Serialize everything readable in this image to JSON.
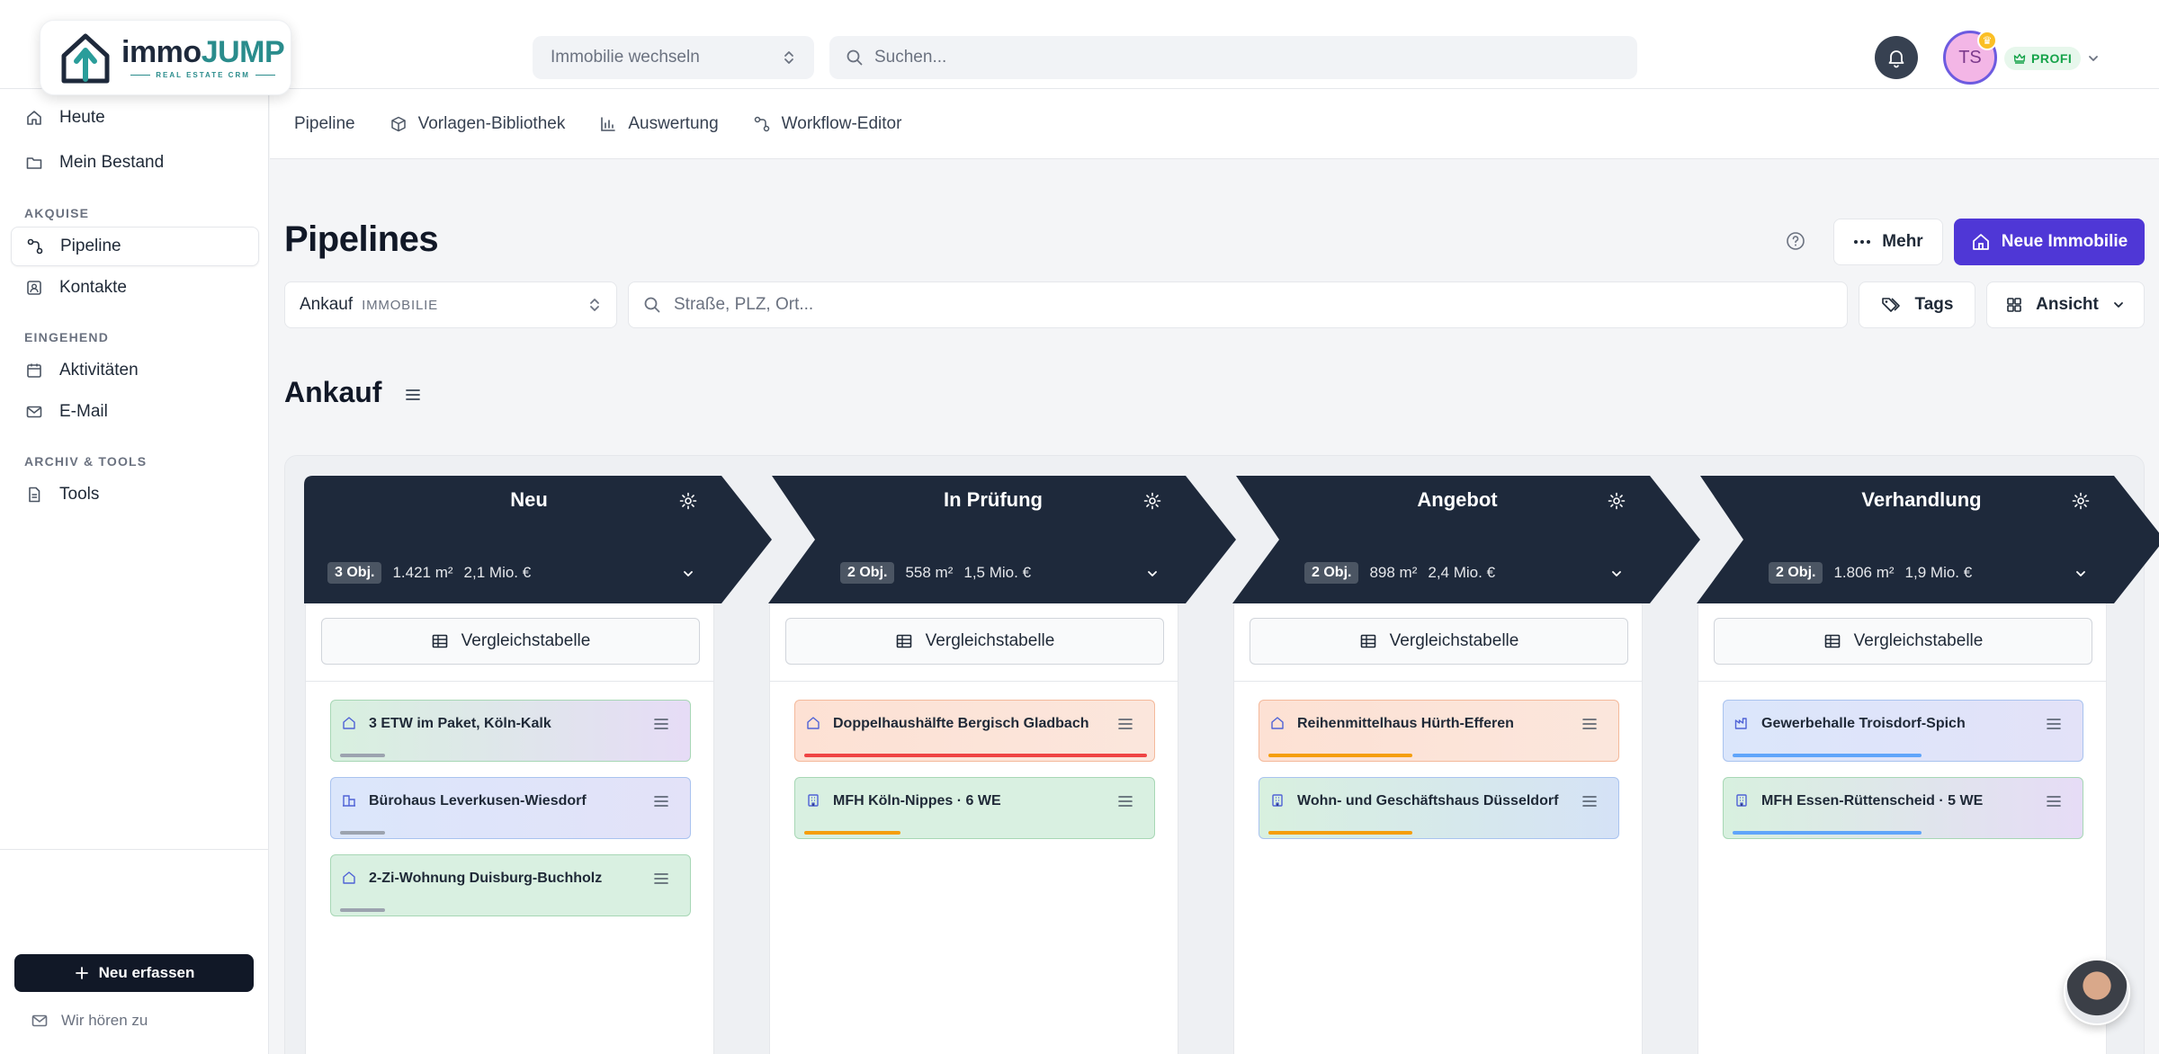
{
  "logo": {
    "word_1": "immo",
    "word_2": "JUMP",
    "tagline": "REAL ESTATE CRM"
  },
  "topbar": {
    "property_switch_label": "Immobilie wechseln",
    "search_placeholder": "Suchen...",
    "avatar_initials": "TS",
    "plan_badge": "PROFI"
  },
  "sidebar": {
    "items_top": [
      {
        "label": "Heute",
        "icon": "home-icon"
      },
      {
        "label": "Mein Bestand",
        "icon": "folder-icon"
      }
    ],
    "section_akquise": "AKQUISE",
    "items_akquise": [
      {
        "label": "Pipeline",
        "icon": "pipeline-icon",
        "active": true
      },
      {
        "label": "Kontakte",
        "icon": "contacts-icon"
      }
    ],
    "section_eingehend": "EINGEHEND",
    "items_eingehend": [
      {
        "label": "Aktivitäten",
        "icon": "calendar-icon"
      },
      {
        "label": "E-Mail",
        "icon": "mail-icon"
      }
    ],
    "section_archiv": "ARCHIV & TOOLS",
    "items_archiv": [
      {
        "label": "Tools",
        "icon": "document-icon"
      }
    ],
    "new_button": "Neu erfassen",
    "feedback": "Wir hören zu"
  },
  "subnav": [
    {
      "label": "Pipeline"
    },
    {
      "label": "Vorlagen-Bibliothek",
      "icon": "cube-icon"
    },
    {
      "label": "Auswertung",
      "icon": "chart-icon"
    },
    {
      "label": "Workflow-Editor",
      "icon": "workflow-icon"
    }
  ],
  "main": {
    "title": "Pipelines",
    "more_button": "Mehr",
    "primary_button": "Neue Immobilie",
    "pipeline_select": "Ankauf",
    "pipeline_select_sub": "IMMOBILIE",
    "address_search_placeholder": "Straße, PLZ, Ort...",
    "tags_button": "Tags",
    "view_button": "Ansicht",
    "section_title": "Ankauf"
  },
  "columns": [
    {
      "title": "Neu",
      "count": "3 Obj.",
      "area": "1.421 m²",
      "value": "2,1 Mio. €",
      "compare_label": "Vergleichstabelle",
      "cards": [
        {
          "title": "3 ETW im Paket, Köln-Kalk",
          "icon": "home-icon",
          "theme": "green-purple",
          "progress": 0.13,
          "bar_color": "#9ca3af"
        },
        {
          "title": "Bürohaus Leverkusen-Wiesdorf",
          "icon": "office-icon",
          "theme": "blue",
          "progress": 0.13,
          "bar_color": "#9ca3af"
        },
        {
          "title": "2-Zi-Wohnung Duisburg-Buchholz",
          "icon": "home-icon",
          "theme": "green",
          "progress": 0.13,
          "bar_color": "#9ca3af"
        }
      ]
    },
    {
      "title": "In Prüfung",
      "count": "2 Obj.",
      "area": "558 m²",
      "value": "1,5 Mio. €",
      "compare_label": "Vergleichstabelle",
      "cards": [
        {
          "title": "Doppelhaushälfte Bergisch Gladbach",
          "icon": "home-icon",
          "theme": "orange",
          "progress": 1.0,
          "bar_color": "#ef4444"
        },
        {
          "title": "MFH Köln-Nippes · 6 WE",
          "icon": "building-icon",
          "theme": "green",
          "progress": 0.28,
          "bar_color": "#f59e0b"
        }
      ]
    },
    {
      "title": "Angebot",
      "count": "2 Obj.",
      "area": "898 m²",
      "value": "2,4 Mio. €",
      "compare_label": "Vergleichstabelle",
      "cards": [
        {
          "title": "Reihenmittelhaus Hürth-Efferen",
          "icon": "home-icon",
          "theme": "orange",
          "progress": 0.42,
          "bar_color": "#f59e0b"
        },
        {
          "title": "Wohn- und Geschäftshaus Düsseldorf",
          "icon": "building-icon",
          "theme": "green-blue",
          "progress": 0.42,
          "bar_color": "#f59e0b"
        }
      ]
    },
    {
      "title": "Verhandlung",
      "count": "2 Obj.",
      "area": "1.806 m²",
      "value": "1,9 Mio. €",
      "compare_label": "Vergleichstabelle",
      "cards": [
        {
          "title": "Gewerbehalle Troisdorf-Spich",
          "icon": "factory-icon",
          "theme": "blue",
          "progress": 0.55,
          "bar_color": "#60a5fa"
        },
        {
          "title": "MFH Essen-Rüttenscheid · 5 WE",
          "icon": "building-icon",
          "theme": "green-purple",
          "progress": 0.55,
          "bar_color": "#60a5fa"
        }
      ]
    }
  ],
  "colors": {
    "primary": "#4f37d6",
    "column_header": "#1e293b",
    "dark_button": "#111827"
  }
}
